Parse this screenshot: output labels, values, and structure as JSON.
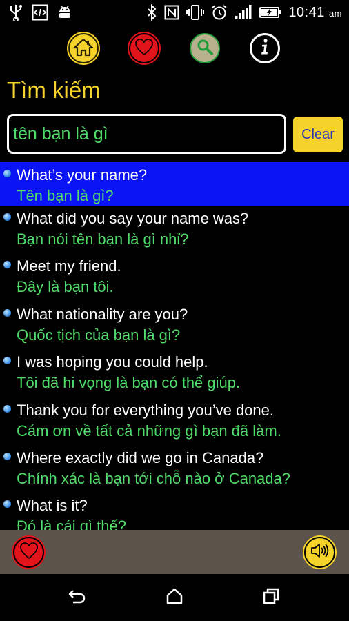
{
  "status_bar": {
    "time": "10:41",
    "ampm": "am",
    "left_icons": [
      "usb-icon",
      "code-icon",
      "android-icon"
    ],
    "right_icons": [
      "bluetooth-icon",
      "nfc-icon",
      "vibrate-icon",
      "alarm-icon",
      "signal-icon",
      "battery-charging-icon"
    ]
  },
  "nav": {
    "icons": [
      "home-icon",
      "heart-icon",
      "search-icon",
      "info-icon"
    ]
  },
  "page_title": "Tìm kiếm",
  "search": {
    "value": "tên bạn là gì",
    "clear_label": "Clear"
  },
  "phrases": [
    {
      "en": "What’s your name?",
      "vi": "Tên bạn là gì?",
      "selected": true
    },
    {
      "en": "What did you say your name was?",
      "vi": "Bạn nói tên bạn là gì nhỉ?"
    },
    {
      "en": "Meet my friend.",
      "vi": "Đây là bạn tôi."
    },
    {
      "en": "What nationality are you?",
      "vi": "Quốc tịch của bạn là gì?"
    },
    {
      "en": "I was hoping you could help.",
      "vi": "Tôi đã hi vọng là bạn có thể giúp."
    },
    {
      "en": "Thank you for everything you’ve done.",
      "vi": "Cám ơn về tất cả những gì bạn đã làm."
    },
    {
      "en": "Where exactly did we go in Canada?",
      "vi": "Chính xác là bạn tới chỗ nào ở Canada?"
    },
    {
      "en": "What is it?",
      "vi": "Đó là cái gì thế?"
    }
  ],
  "bottom_bar": {
    "icons": [
      "heart-icon",
      "speaker-icon"
    ]
  },
  "system_nav": {
    "icons": [
      "back-icon",
      "home-outline-icon",
      "recents-icon"
    ]
  },
  "colors": {
    "accent_yellow": "#f6d32a",
    "selected_row": "#0a14f5",
    "vietnamese_text": "#4fdc6a",
    "favorite_red": "#e1141b",
    "bottom_bar": "#5c544a"
  }
}
